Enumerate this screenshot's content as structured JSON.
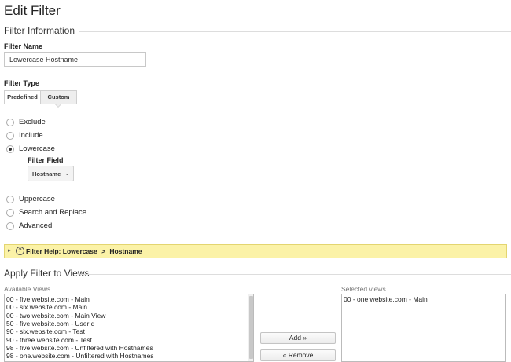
{
  "page_title": "Edit Filter",
  "filter_information": {
    "section_title": "Filter Information",
    "filter_name_label": "Filter Name",
    "filter_name_value": "Lowercase Hostname",
    "filter_type_label": "Filter Type",
    "tabs": [
      {
        "label": "Predefined",
        "active": false
      },
      {
        "label": "Custom",
        "active": true
      }
    ],
    "options": [
      {
        "label": "Exclude",
        "checked": false
      },
      {
        "label": "Include",
        "checked": false
      },
      {
        "label": "Lowercase",
        "checked": true
      },
      {
        "label": "Uppercase",
        "checked": false
      },
      {
        "label": "Search and Replace",
        "checked": false
      },
      {
        "label": "Advanced",
        "checked": false
      }
    ],
    "filter_field_label": "Filter Field",
    "filter_field_value": "Hostname",
    "filter_help": {
      "prefix": "Filter Help: Lowercase",
      "separator": ">",
      "suffix": "Hostname"
    }
  },
  "apply_filter": {
    "section_title": "Apply Filter to Views",
    "available_label": "Available Views",
    "available_views": [
      "00 - five.website.com - Main",
      "00 - six.website.com - Main",
      "00 - two.website.com - Main View",
      "50 - five.website.com - UserId",
      "90 - six.website.com - Test",
      "90 - three.website.com - Test",
      "98 - five.website.com - Unfiltered with Hostnames",
      "98 - one.website.com - Unfiltered with Hostnames"
    ],
    "add_label": "Add »",
    "remove_label": "« Remove",
    "selected_label": "Selected views",
    "selected_views": [
      "00 - one.website.com - Main"
    ]
  },
  "colors": {
    "help_bar_bg": "#fbf2a7",
    "help_bar_border": "#e3d570",
    "active_tab_bg": "#eeeeee"
  },
  "icons": {
    "help_expand": "triangle-right-icon",
    "help_circle": "question-circle-icon",
    "select_arrow": "chevron-down-icon"
  }
}
